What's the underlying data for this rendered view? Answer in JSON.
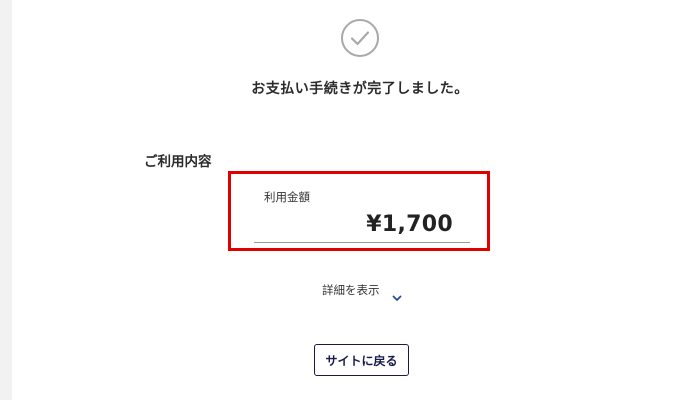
{
  "status": {
    "icon": "check-circle-icon",
    "message": "お支払い手続きが完了しました。"
  },
  "usage": {
    "section_title": "ご利用内容",
    "amount_label": "利用金額",
    "amount_value": "¥1,700"
  },
  "details": {
    "toggle_label": "詳細を表示",
    "icon": "chevron-down-icon"
  },
  "actions": {
    "back_label": "サイトに戻る"
  },
  "colors": {
    "highlight_border": "#e00000",
    "button_border": "#1a1a4a",
    "chevron": "#2c4a9a",
    "check_icon": "#a9a9a9"
  }
}
